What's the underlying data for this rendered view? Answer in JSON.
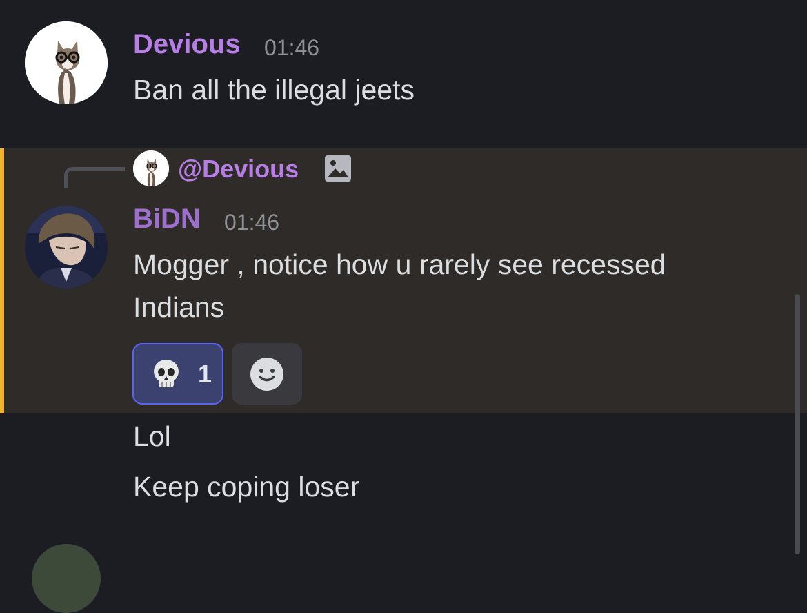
{
  "messages": [
    {
      "author": "Devious",
      "author_color": "#b77fe6",
      "timestamp": "01:46",
      "content": "Ban all the illegal jeets",
      "avatar": "cat-with-glasses-avatar"
    },
    {
      "author": "BiDN",
      "author_color": "#9f6fd0",
      "timestamp": "01:46",
      "content": "Mogger , notice how u rarely see recessed Indians",
      "avatar": "anime-boy-avatar",
      "highlighted": true,
      "highlight_color": "#f0b132",
      "reply": {
        "mention": "@Devious",
        "mention_color": "#b77fe6",
        "has_image": true,
        "avatar": "cat-with-glasses-avatar"
      },
      "reactions": [
        {
          "emoji": "skull-emoji",
          "count": "1",
          "reacted": true
        }
      ],
      "add_reaction_icon": "smiley-add-reaction-icon"
    }
  ],
  "followups": [
    {
      "content": "Lol"
    },
    {
      "content": "Keep coping loser"
    }
  ],
  "colors": {
    "background": "#1c1d22",
    "highlight_background": "#2e2b28",
    "reaction_border": "#5865f2",
    "timestamp": "#8e9297"
  }
}
